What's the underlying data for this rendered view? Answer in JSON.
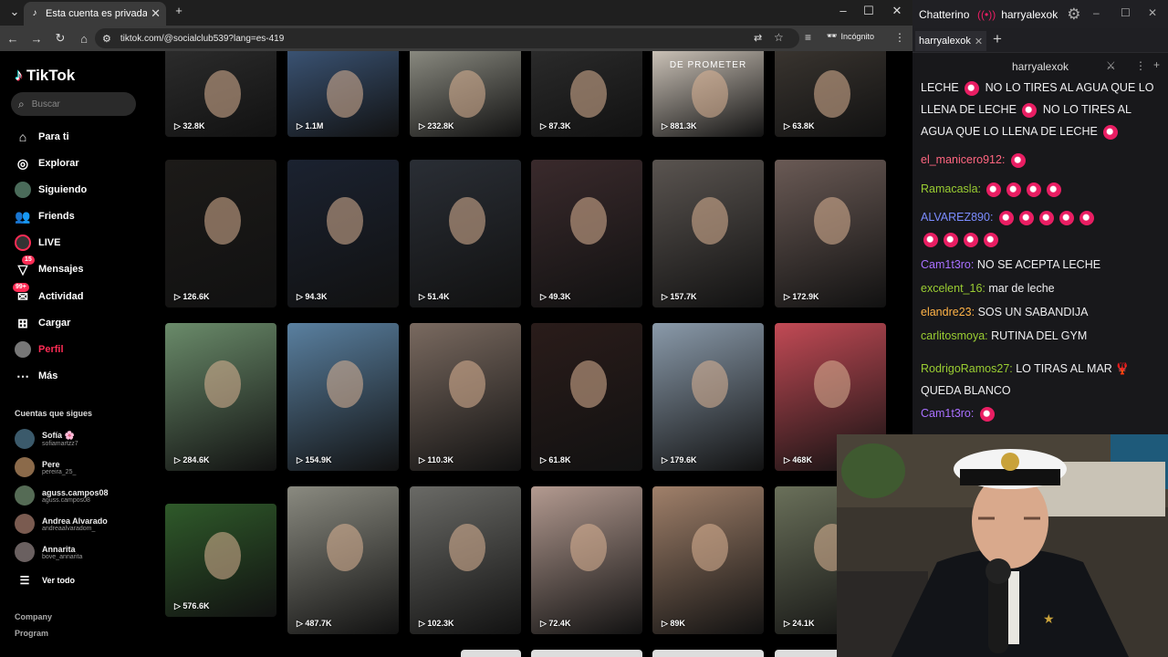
{
  "browser": {
    "tab_title": "Esta cuenta es privada. Sigue e...",
    "url": "tiktok.com/@socialclub539?lang=es-419",
    "incognito_label": "Incógnito"
  },
  "sidebar": {
    "logo": "TikTok",
    "search_placeholder": "Buscar",
    "nav": [
      {
        "label": "Para ti",
        "icon": "home-icon"
      },
      {
        "label": "Explorar",
        "icon": "compass-icon"
      },
      {
        "label": "Siguiendo",
        "icon": "following-avatar-icon"
      },
      {
        "label": "Friends",
        "icon": "friends-icon"
      },
      {
        "label": "LIVE",
        "icon": "live-icon"
      },
      {
        "label": "Mensajes",
        "icon": "messages-icon",
        "badge": "15"
      },
      {
        "label": "Actividad",
        "icon": "activity-icon",
        "badge": "99+"
      },
      {
        "label": "Cargar",
        "icon": "upload-icon"
      },
      {
        "label": "Perfil",
        "icon": "profile-avatar-icon"
      },
      {
        "label": "Más",
        "icon": "more-icon"
      }
    ],
    "following_title": "Cuentas que sigues",
    "following": [
      {
        "name": "Sofía 🌸",
        "handle": "sofiamartzz7"
      },
      {
        "name": "Pere",
        "handle": "pereira_25_"
      },
      {
        "name": "aguss.campos08",
        "handle": "aguss.campos08"
      },
      {
        "name": "Andrea Alvarado",
        "handle": "andreaalvaradom_"
      },
      {
        "name": "Annarita",
        "handle": "bove_annarita"
      }
    ],
    "see_all": "Ver todo",
    "footer": [
      "Company",
      "Program"
    ]
  },
  "grid": {
    "banner_text": "DE PROMETER",
    "rows": [
      [
        "32.8K",
        "1.1M",
        "232.8K",
        "87.3K",
        "881.3K",
        "63.8K"
      ],
      [
        "126.6K",
        "94.3K",
        "51.4K",
        "49.3K",
        "157.7K",
        "172.9K"
      ],
      [
        "284.6K",
        "154.9K",
        "110.3K",
        "61.8K",
        "179.6K",
        "468K"
      ],
      [
        "576.6K",
        "487.7K",
        "102.3K",
        "72.4K",
        "89K",
        "24.1K"
      ]
    ]
  },
  "chat": {
    "app_title": "Chatterino",
    "channel": "harryalexok",
    "tab_label": "harryalexok",
    "header_channel": "harryalexok",
    "messages": [
      {
        "user": "",
        "text": "LECHE",
        "color": "#efeff1"
      },
      {
        "user": "el_manicero912:",
        "text": "",
        "color": "#ff6680"
      },
      {
        "user": "Ramacasla:",
        "text": "",
        "color": "#9acd32"
      },
      {
        "user": "ALVAREZ890:",
        "text": "",
        "color": "#7b8cff"
      },
      {
        "user": "Cam1t3ro:",
        "text": "NO SE ACEPTA LECHE",
        "color": "#a970ff"
      },
      {
        "user": "excelent_16:",
        "text": "mar de leche",
        "color": "#9acd32"
      },
      {
        "user": "elandre23:",
        "text": "SOS UN SABANDIJA",
        "color": "#ffb347"
      },
      {
        "user": "carlitosmoya:",
        "text": "RUTINA DEL GYM",
        "color": "#9acd32"
      },
      {
        "user": "RodrigoRamos27:",
        "text": "LO TIRAS AL MAR",
        "color": "#9acd32"
      },
      {
        "user": "Cam1t3ro:",
        "text": "",
        "color": "#a970ff"
      }
    ],
    "first_line_rest": "NO LO TIRES AL AGUA QUE LO LLENA DE LECHE",
    "first_line_rest2": "NO LO TIRES AL AGUA QUE LO LLENA DE LECHE",
    "rodrigo_cont": "QUEDA BLANCO"
  }
}
